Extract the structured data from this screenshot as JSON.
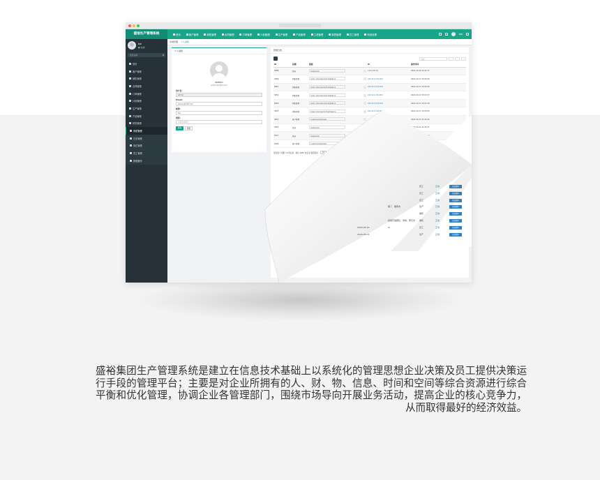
{
  "app": {
    "brand": "盛裕生产管理系统",
    "top_nav": [
      "首页",
      "客户管理",
      "销售管理",
      "合同管理",
      "订单管理",
      "计划管理",
      "生产管理",
      "产品管理",
      "工资管理",
      "报表管理",
      "员工管理",
      "系统设置"
    ],
    "user_name": "bai",
    "user_status": "● 在线",
    "sidebar_search_placeholder": "搜索菜单",
    "sidebar": [
      "首页",
      "客户管理",
      "销售管理",
      "合同管理",
      "订单管理",
      "计划管理",
      "生产管理",
      "产品管理",
      "财务管理",
      "系统管理"
    ],
    "sidebar_sub": [
      "日志管理",
      "岗位管理",
      "员工管理",
      "数据备份"
    ],
    "breadcrumbs": [
      "系统管理",
      "个人资料"
    ]
  },
  "profile": {
    "panel_title": "个人资料",
    "name": "admin",
    "email": "admin@126.com",
    "fields": [
      {
        "label": "用户名:",
        "value": "admin",
        "disabled": true
      },
      {
        "label": "Email:",
        "value": "admin@126.com",
        "disabled": false
      },
      {
        "label": "昵称:",
        "value": "bai",
        "disabled": false
      },
      {
        "label": "密码:",
        "value": "不修改请留空",
        "placeholder": true
      }
    ],
    "submit": "提交",
    "reset": "重置"
  },
  "log": {
    "panel_title": "登录日志",
    "search_placeholder": "搜索",
    "columns": [
      "ID",
      "标题",
      "链接",
      "",
      "IP",
      "操作时间"
    ],
    "rows": [
      {
        "id": "3668",
        "title": "登录",
        "url": "/index/login",
        "ip": "116.6.64.32",
        "time": "2020-10-16 14:21:17"
      },
      {
        "id": "3666",
        "title": "销售管理",
        "url": "/order_info/index?ref=addtabs=1",
        "ip": "222.211.234.209",
        "time": "2020-10-17 23:04:36"
      },
      {
        "id": "3667",
        "title": "销售管理",
        "url": "/order_info/index?ref=addtabs=1",
        "ip": "222.211.234.209",
        "time": "2020-10-17 23:03:49"
      },
      {
        "id": "3659",
        "title": "销售管理",
        "url": "/order_info/index?ref=addtabs=1",
        "ip": "222.211.234.209",
        "time": "2020-10-17 23:03:37"
      },
      {
        "id": "3660",
        "title": "销售管理",
        "url": "/order_info/index?ref=addtabs=1",
        "ip": "222.211.234.209",
        "time": "2020-10-17 23:03:18"
      },
      {
        "id": "3655",
        "title": "销售管理",
        "url": "/order_info/index?ref=addtabs=1",
        "ip": "222.211.234.209",
        "time": "2020-10-17 23:03:05"
      },
      {
        "id": "3653",
        "title": "客户管理",
        "url": "/customer/index/ajax",
        "ip": "",
        "time": "2020-10-17 21:24:10"
      },
      {
        "id": "3652",
        "title": "登录",
        "url": "/index/login",
        "ip": "",
        "time": "2020-10-17 21:22:37"
      },
      {
        "id": "2937",
        "title": "登录",
        "url": "/index/login",
        "ip": "",
        "time": "2020-10-16 17:58:14"
      },
      {
        "id": "2906",
        "title": "客户管理",
        "url": "/customer/index/ajax",
        "ip": "",
        "time": "2020-10-14 17:48:00"
      }
    ],
    "pager": "显示第 1 到第 10 条记录，总共 2681 条记录 每页显示",
    "page_size": "10",
    "page_tail": "上一页 1 下一页",
    "last_label": "跳转"
  },
  "under_page": {
    "rows": [
      {
        "c1": "",
        "c2": "",
        "c3": "员工",
        "op": "正常",
        "btn": "修改资料"
      },
      {
        "c1": "",
        "c2": "",
        "c3": "员工",
        "op": "正常",
        "btn": "修改资料"
      },
      {
        "c1": "",
        "c2": "",
        "c3": "员工",
        "op": "正常",
        "btn": "修改资料"
      },
      {
        "c1": "",
        "c2": "猪了：童家杰",
        "c3": "生产",
        "op": "正常",
        "btn": "修改资料"
      },
      {
        "c1": "",
        "c2": "",
        "c3": "销售",
        "op": "正常",
        "btn": "修改资料"
      },
      {
        "c1": "",
        "c2": "感谢开发团队：张焯，李元杰",
        "c3": "销售",
        "op": "正常",
        "btn": "修改资料"
      },
      {
        "c1": "2020-05-16",
        "c2": "AI",
        "c3": "员工",
        "op": "正常",
        "btn": "修改资料"
      },
      {
        "c1": "2020-05-01",
        "c2": "",
        "c3": "生产",
        "op": "正常",
        "btn": "修改资料"
      }
    ]
  },
  "description": "盛裕集团生产管理系统是建立在信息技术基础上以系统化的管理思想企业决策及员工提供决策运行手段的管理平台；主要是对企业所拥有的人、财、物、信息、时间和空间等综合资源进行综合平衡和优化管理，协调企业各管理部门，围绕市场导向开展业务活动，提高企业的核心竞争力，从而取得最好的经济效益。"
}
